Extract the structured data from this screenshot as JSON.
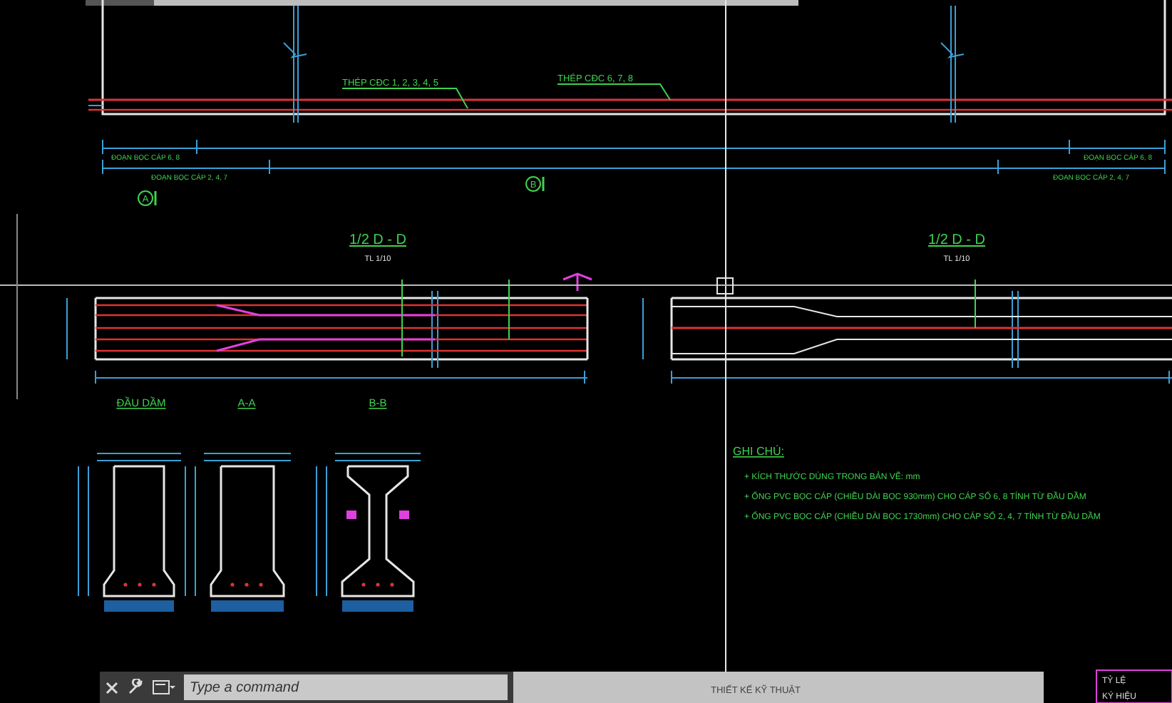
{
  "drawing": {
    "callouts": [
      {
        "text": "THÉP CĐC 1, 2, 3, 4, 5"
      },
      {
        "text": "THÉP CĐC 6, 7, 8"
      }
    ],
    "dimension_notes": [
      "ĐOẠN BỌC CÁP 6, 8",
      "ĐOẠN BỌC CÁP 2, 4, 7",
      "ĐOẠN BỌC CÁP 6, 8",
      "ĐOẠN BỌC CÁP 2, 4, 7"
    ],
    "section_markers": [
      "A",
      "B"
    ],
    "views": [
      {
        "title": "1/2 D - D",
        "scale": "TL 1/10",
        "kind": "tendons"
      },
      {
        "title": "1/2 D - D",
        "scale": "TL 1/10",
        "kind": "profile"
      }
    ],
    "sections": [
      {
        "title": "ĐẦU DẦM",
        "kind": "solid"
      },
      {
        "title": "A-A",
        "kind": "solid"
      },
      {
        "title": "B-B",
        "kind": "ibeam"
      }
    ],
    "notes": {
      "title": "GHI CHÚ:",
      "items": [
        "+ KÍCH THƯỚC DÙNG TRONG BẢN VẼ: mm",
        "+ ỐNG PVC BỌC CÁP (CHIỀU DÀI BỌC 930mm) CHO CÁP SỐ 6, 8 TÍNH TỪ ĐẦU DẦM",
        "+ ỐNG PVC BỌC CÁP (CHIỀU DÀI BỌC 1730mm) CHO CÁP SỐ 2, 4, 7 TÍNH TỪ ĐẦU DẦM"
      ]
    },
    "title_block": {
      "center": "THIẾT KẾ KỸ THUẬT",
      "labels": [
        "TỶ LỆ",
        "KÝ HIỆU"
      ]
    }
  },
  "command_line": {
    "placeholder": "Type a command"
  }
}
